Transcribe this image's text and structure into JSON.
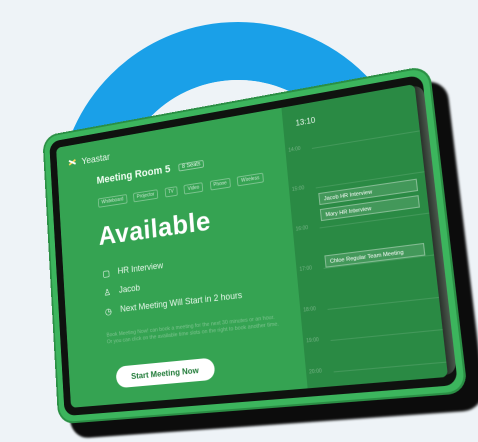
{
  "brand": {
    "logo_text": "Yeastar"
  },
  "room": {
    "name": "Meeting Room 5",
    "badge": "8 Seats",
    "tags": [
      "Whiteboard",
      "Projector",
      "TV",
      "Video",
      "Phone",
      "Wireless"
    ]
  },
  "status": {
    "label": "Available"
  },
  "meeting": {
    "title": "HR Interview",
    "organizer": "Jacob",
    "next_notice": "Next Meeting Will Start in 2 hours",
    "description": "Book Meeting Now! can book a meeting for the next 30 minutes or an hour. Or you can click on the available time slots on the right to book another time.",
    "cta_label": "Start Meeting Now"
  },
  "schedule": {
    "current_time": "13:10",
    "time_labels": [
      "14:00",
      "15:00",
      "16:00",
      "17:00",
      "18:00",
      "19:00",
      "20:00"
    ],
    "events": [
      {
        "label": "Jacob  HR Interview"
      },
      {
        "label": "Mary  HR Interview"
      },
      {
        "label": "Chloe  Regular Team Meeting"
      }
    ]
  },
  "colors": {
    "ring": "#1aa0e8",
    "screen_green": "#35a352",
    "timeline_green": "#2a8a44",
    "tablet_frame": "#3cb55d",
    "bezel": "#0f120f"
  },
  "icons": {
    "logo": "yeastar-logo-icon",
    "meeting": "calendar-icon",
    "organizer": "person-icon",
    "next": "clock-icon"
  }
}
